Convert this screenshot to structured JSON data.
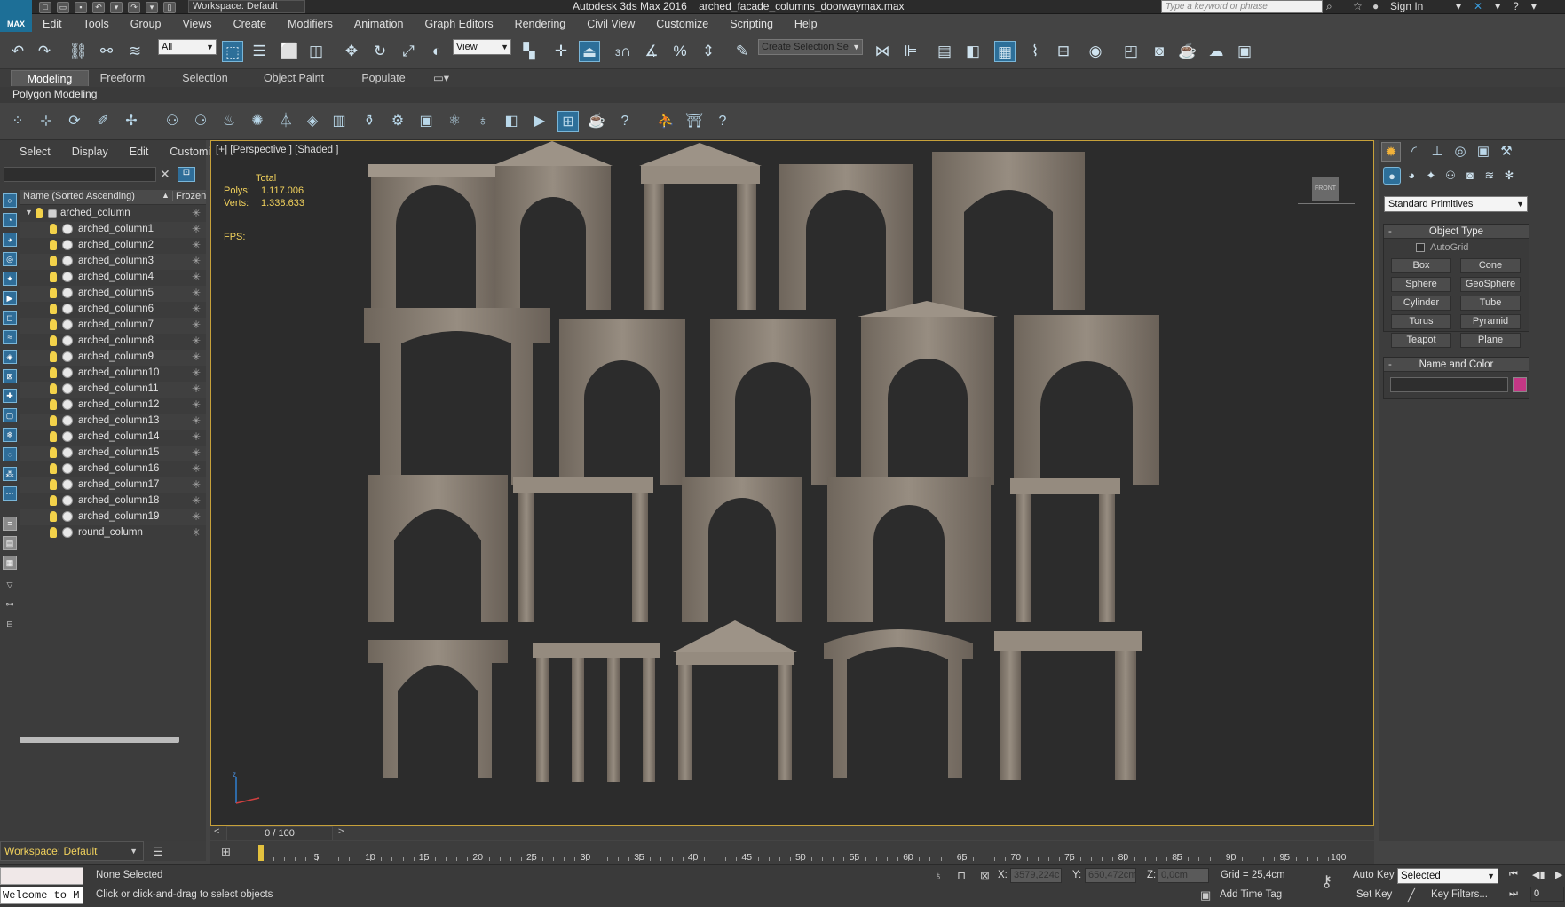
{
  "titlebar": {
    "logo_text": "MAX",
    "workspace": "Workspace: Default",
    "app_title": "Autodesk 3ds Max 2016    arched_facade_columns_doorwaymax.max",
    "search_placeholder": "Type a keyword or phrase",
    "sign_in": "Sign In",
    "help": "?"
  },
  "menu": [
    "Edit",
    "Tools",
    "Group",
    "Views",
    "Create",
    "Modifiers",
    "Animation",
    "Graph Editors",
    "Rendering",
    "Civil View",
    "Customize",
    "Scripting",
    "Help"
  ],
  "main_toolbar": {
    "selection_filter": "All",
    "reference_coord": "View",
    "snap_number": "3",
    "named_selection_placeholder": "Create Selection Se"
  },
  "ribbon": {
    "tabs": [
      "Modeling",
      "Freeform",
      "Selection",
      "Object Paint",
      "Populate"
    ],
    "active_tab": "Modeling",
    "panel_label": "Polygon Modeling"
  },
  "scene_explorer": {
    "menu": [
      "Select",
      "Display",
      "Edit",
      "Customize"
    ],
    "column_name": "Name (Sorted Ascending)",
    "column_frozen": "Frozen",
    "root": "arched_column",
    "items": [
      "arched_column1",
      "arched_column2",
      "arched_column3",
      "arched_column4",
      "arched_column5",
      "arched_column6",
      "arched_column7",
      "arched_column8",
      "arched_column9",
      "arched_column10",
      "arched_column11",
      "arched_column12",
      "arched_column13",
      "arched_column14",
      "arched_column15",
      "arched_column16",
      "arched_column17",
      "arched_column18",
      "arched_column19",
      "round_column"
    ]
  },
  "viewport": {
    "label": "[+] [Perspective ] [Shaded ]",
    "stats_header": "Total",
    "polys_label": "Polys:",
    "polys_value": "1.117.006",
    "verts_label": "Verts:",
    "verts_value": "1.338.633",
    "fps_label": "FPS:",
    "viewcube_label": "FRONT",
    "object_color": "#8f857a"
  },
  "command_panel": {
    "category": "Standard Primitives",
    "object_type_title": "Object Type",
    "autogrid": "AutoGrid",
    "primitives": [
      "Box",
      "Cone",
      "Sphere",
      "GeoSphere",
      "Cylinder",
      "Tube",
      "Torus",
      "Pyramid",
      "Teapot",
      "Plane"
    ],
    "name_color_title": "Name and Color",
    "object_color": "#c43785"
  },
  "timeline": {
    "frame_display": "0 / 100",
    "ticks": [
      "5",
      "10",
      "15",
      "20",
      "25",
      "30",
      "35",
      "40",
      "45",
      "50",
      "55",
      "60",
      "65",
      "70",
      "75",
      "80",
      "85",
      "90",
      "95",
      "100"
    ]
  },
  "statusbar": {
    "workspace": "Workspace: Default",
    "maxscript_text": "Welcome to M",
    "selection_status": "None Selected",
    "prompt": "Click or click-and-drag to select objects",
    "x_label": "X:",
    "x_value": "3579,224c",
    "y_label": "Y:",
    "y_value": "650,472cm",
    "z_label": "Z:",
    "z_value": "0,0cm",
    "grid": "Grid = 25,4cm",
    "add_time_tag": "Add Time Tag",
    "auto_key": "Auto Key",
    "set_key": "Set Key",
    "key_mode": "Selected",
    "key_filters": "Key Filters...",
    "current_frame": "0"
  }
}
